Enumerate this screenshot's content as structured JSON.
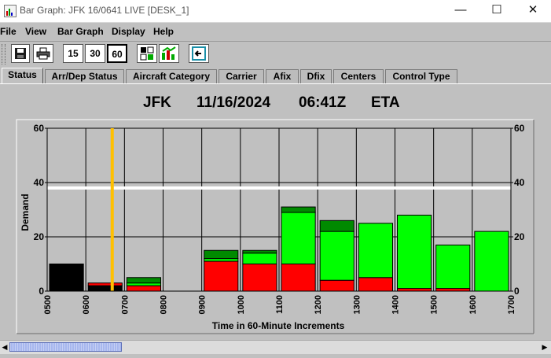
{
  "window": {
    "title": "Bar Graph: JFK 16/0641 LIVE [DESK_1]",
    "controls": {
      "minimize": "—",
      "maximize": "☐",
      "close": "✕"
    }
  },
  "menu": [
    {
      "label": "File"
    },
    {
      "label": "View"
    },
    {
      "label": "Bar Graph"
    },
    {
      "label": "Display"
    },
    {
      "label": "Help"
    }
  ],
  "toolbar": {
    "buttons": [
      {
        "icon": "save-icon"
      },
      {
        "icon": "print-icon"
      },
      {
        "label": "15"
      },
      {
        "label": "30"
      },
      {
        "label": "60",
        "selected": true
      },
      {
        "icon": "grid-settings-icon"
      },
      {
        "icon": "chart-update-icon"
      },
      {
        "icon": "export-icon"
      }
    ]
  },
  "tabs": [
    {
      "label": "Status",
      "active": true
    },
    {
      "label": "Arr/Dep Status"
    },
    {
      "label": "Aircraft Category"
    },
    {
      "label": "Carrier"
    },
    {
      "label": "Afix"
    },
    {
      "label": "Dfix"
    },
    {
      "label": "Centers"
    },
    {
      "label": "Control Type"
    }
  ],
  "header": {
    "airport": "JFK",
    "date": "11/16/2024",
    "time": "06:41Z",
    "mode": "ETA"
  },
  "colors": {
    "active": "#000000",
    "red": "#ff0000",
    "dark_green": "#008a00",
    "light_green": "#00ff00",
    "time_marker": "#ffc000",
    "capacity_line": "#ffffff",
    "plot_bg": "#c0c0c0"
  },
  "chart_data": {
    "type": "bar",
    "stacked": true,
    "xlabel": "Time in 60-Minute Increments",
    "ylabel": "Demand",
    "ylim": [
      0,
      60
    ],
    "yticks": [
      0,
      20,
      40,
      60
    ],
    "capacity": 38,
    "current_time_marker": "0641",
    "x_tick_labels": [
      "0500",
      "0600",
      "0700",
      "0800",
      "0900",
      "1000",
      "1100",
      "1200",
      "1300",
      "1400",
      "1500",
      "1600",
      "1700"
    ],
    "categories": [
      "0500",
      "0600",
      "0700",
      "0800",
      "0900",
      "1000",
      "1100",
      "1200",
      "1300",
      "1400",
      "1500",
      "1600"
    ],
    "series": [
      {
        "color": "#000000",
        "values": [
          10,
          2,
          0,
          0,
          0,
          0,
          0,
          0,
          0,
          0,
          0,
          0
        ]
      },
      {
        "color": "#ff0000",
        "values": [
          0,
          1,
          2,
          0,
          11,
          10,
          10,
          4,
          5,
          1,
          1,
          0
        ]
      },
      {
        "color": "#00ff00",
        "values": [
          0,
          0,
          1,
          0,
          1,
          4,
          19,
          18,
          20,
          27,
          16,
          22
        ]
      },
      {
        "color": "#008a00",
        "values": [
          0,
          0,
          2,
          0,
          3,
          1,
          2,
          4,
          0,
          0,
          0,
          0
        ]
      }
    ],
    "grid": true
  },
  "scrollbar": {
    "left_arrow": "◀",
    "right_arrow": "▶"
  }
}
